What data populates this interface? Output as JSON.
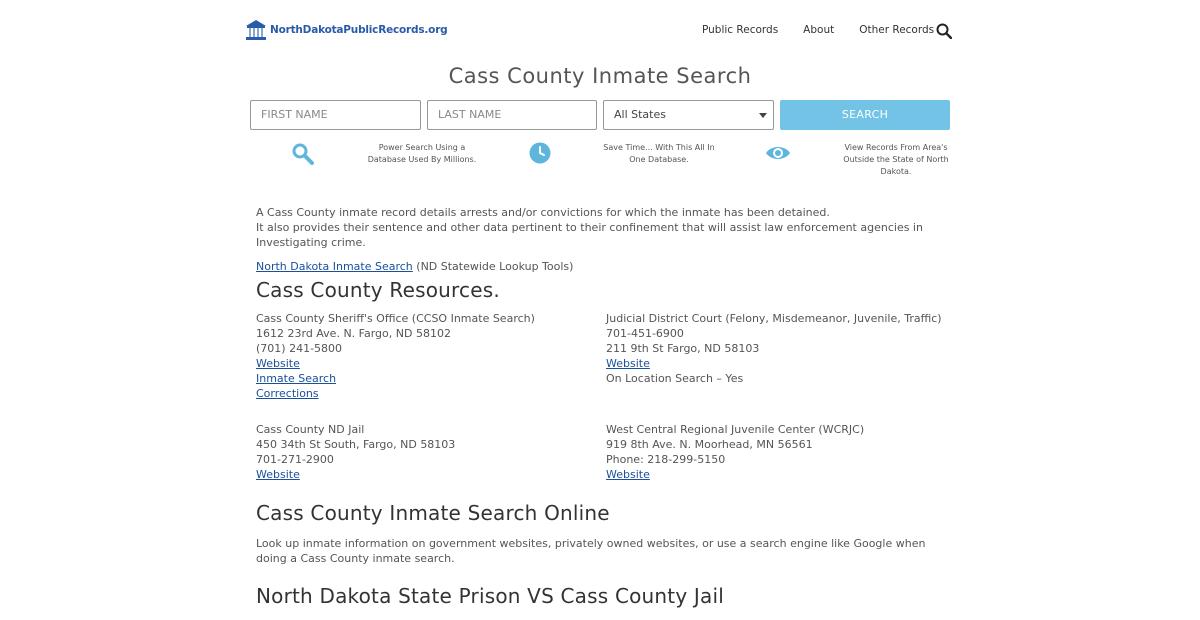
{
  "header": {
    "logo_text": "NorthDakotaPublicRecords.org",
    "nav": [
      "Public Records",
      "About",
      "Other Records"
    ]
  },
  "page_title": "Cass County Inmate Search",
  "search_form": {
    "first_name_placeholder": "FIRST NAME",
    "last_name_placeholder": "LAST NAME",
    "state_selected": "All States",
    "search_button": "SEARCH"
  },
  "features": [
    {
      "icon": "magnifier-icon",
      "text_line1": "Power Search Using a",
      "text_line2": "Database Used By Millions.",
      "text_line3": ""
    },
    {
      "icon": "clock-icon",
      "text_line1": "Save Time... With This All In",
      "text_line2": "One Database.",
      "text_line3": ""
    },
    {
      "icon": "eye-icon",
      "text_line1": "View Records From Area's",
      "text_line2": "Outside the State of North",
      "text_line3": "Dakota."
    }
  ],
  "intro": {
    "line1": "A Cass County inmate record details arrests and/or convictions for which the inmate has been detained.",
    "line2": "It also provides their sentence and other data pertinent to their confinement that will assist law enforcement agencies in Investigating crime.",
    "link_text": "North Dakota Inmate Search",
    "link_suffix": " (ND Statewide Lookup Tools)"
  },
  "resources_heading": "Cass County Resources.",
  "resources": {
    "sheriff": {
      "name": "Cass County Sheriff's Office (CCSO Inmate Search)",
      "address": "1612 23rd Ave. N. Fargo, ND 58102",
      "phone": "(701) 241-5800",
      "link1": "Website",
      "link2": "Inmate Search",
      "link3": "Corrections"
    },
    "court": {
      "name": "Judicial District Court (Felony, Misdemeanor, Juvenile, Traffic)",
      "phone": "701-451-6900",
      "address": "211 9th St Fargo, ND 58103",
      "link1": "Website",
      "note": "On Location Search – Yes"
    },
    "jail": {
      "name": "Cass County ND Jail",
      "address": "450 34th St South, Fargo, ND 58103",
      "phone": "701-271-2900",
      "link1": "Website"
    },
    "juvenile": {
      "name": "West Central Regional Juvenile Center (WCRJC)",
      "address": "919 8th Ave. N. Moorhead, MN 56561",
      "phone": "Phone: 218-299-5150",
      "link1": "Website"
    }
  },
  "online_heading": "Cass County Inmate Search Online",
  "online_text": "Look up inmate information on government websites, privately owned websites, or use a search engine like Google when doing a Cass County inmate search.",
  "prison_heading": "North Dakota State Prison VS Cass County Jail",
  "colors": {
    "accent": "#72c3e5",
    "link": "#1a4f9c",
    "logo": "#2a5ba8"
  }
}
